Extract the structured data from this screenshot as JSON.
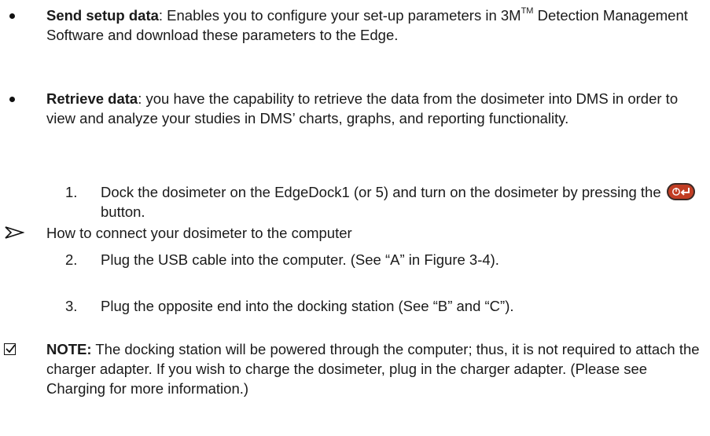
{
  "bullets": [
    {
      "term": "Send setup data",
      "text_before_tm": ":  Enables you to configure your set-up parameters in 3M",
      "tm": "TM",
      "text_after_tm": " Detection Management Software and download  these parameters to the Edge."
    },
    {
      "term": "Retrieve data",
      "text": ":  you have the capability to retrieve the data from the dosimeter into DMS in order to view and analyze your studies in DMS’ charts, graphs, and reporting functionality."
    }
  ],
  "section": {
    "heading": "How to connect your dosimeter to the computer",
    "steps": [
      {
        "number": "1.",
        "text_before_icon": "Dock the dosimeter on the EdgeDock1 (or 5) and turn on the dosimeter by pressing the ",
        "icon": "power-enter-button-icon",
        "text_after_icon": " button."
      },
      {
        "number": "2.",
        "text": "Plug the USB cable into the computer. (See “A” in Figure 3-4)."
      },
      {
        "number": "3.",
        "text": "Plug the opposite end into the docking station (See “B” and “C”)."
      }
    ]
  },
  "note": {
    "label": "NOTE:",
    "text": "  The docking station will be powered through the computer; thus, it is not required to attach the charger adapter.  If you wish to charge the dosimeter, plug in the charger adapter.  (Please see Charging for more information.)"
  },
  "colors": {
    "text": "#1a1a1a",
    "icon_red": "#c23e24"
  }
}
